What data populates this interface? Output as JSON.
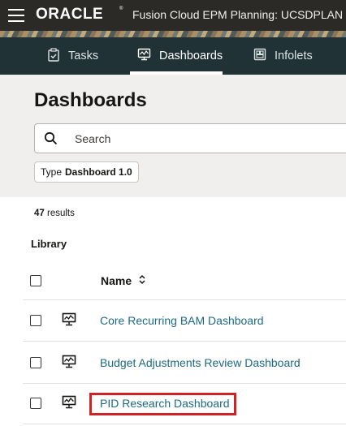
{
  "topbar": {
    "logo": "ORACLE",
    "app_title": "Fusion Cloud EPM Planning:  UCSDPLAN"
  },
  "nav": {
    "tabs": [
      {
        "label": "Tasks",
        "icon": "clipboard-check-icon"
      },
      {
        "label": "Dashboards",
        "icon": "dashboard-monitor-icon",
        "active": true
      },
      {
        "label": "Infolets",
        "icon": "infolets-grid-icon"
      }
    ]
  },
  "header": {
    "title": "Dashboards",
    "search_placeholder": "Search",
    "filter_chip": {
      "key": "Type",
      "value": "Dashboard 1.0"
    }
  },
  "results": {
    "count": "47",
    "count_suffix": "results",
    "section": "Library",
    "column_name": "Name",
    "rows": [
      {
        "name": "Core Recurring BAM Dashboard",
        "icon": "dashboard-icon"
      },
      {
        "name": "Budget Adjustments Review Dashboard",
        "icon": "dashboard-icon"
      },
      {
        "name": "PID Research Dashboard",
        "icon": "dashboard-icon",
        "highlighted": true
      }
    ]
  },
  "colors": {
    "topbar": "#2c2a27",
    "navbar": "#213236",
    "header_bg": "#f1efed",
    "link": "#1b6a85",
    "highlight": "#d22027"
  }
}
